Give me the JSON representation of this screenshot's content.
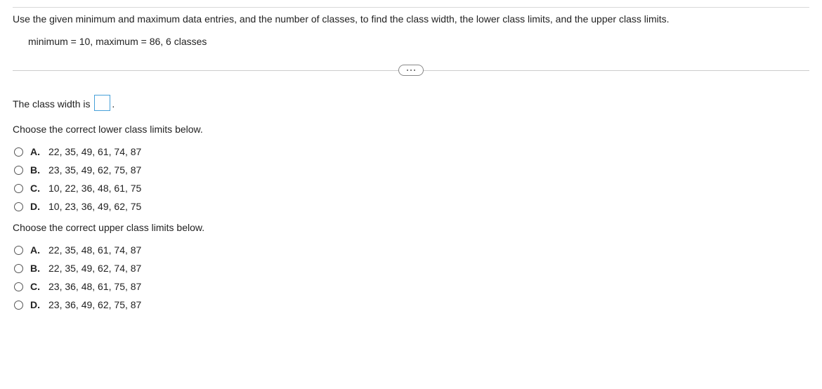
{
  "instruction": "Use the given minimum and maximum data entries, and the number of classes, to find the class width, the lower class limits, and the upper class limits.",
  "params": "minimum = 10,  maximum = 86, 6 classes",
  "q1_prefix": "The class width is ",
  "q1_suffix": ".",
  "lower_prompt": "Choose the correct lower class limits below.",
  "upper_prompt": "Choose the correct upper class limits below.",
  "lower_options": [
    {
      "letter": "A.",
      "text": "22, 35, 49, 61, 74, 87"
    },
    {
      "letter": "B.",
      "text": "23, 35, 49, 62, 75, 87"
    },
    {
      "letter": "C.",
      "text": "10, 22, 36, 48, 61, 75"
    },
    {
      "letter": "D.",
      "text": "10, 23, 36, 49, 62, 75"
    }
  ],
  "upper_options": [
    {
      "letter": "A.",
      "text": "22, 35, 48, 61, 74, 87"
    },
    {
      "letter": "B.",
      "text": "22, 35, 49, 62, 74, 87"
    },
    {
      "letter": "C.",
      "text": "23, 36, 48, 61, 75, 87"
    },
    {
      "letter": "D.",
      "text": "23, 36, 49, 62, 75, 87"
    }
  ]
}
